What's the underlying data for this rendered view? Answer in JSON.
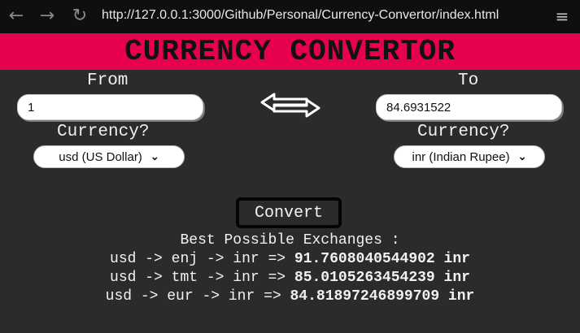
{
  "browser": {
    "url": "http://127.0.0.1:3000/Github/Personal/Currency-Convertor/index.html",
    "back_icon": "←",
    "forward_icon": "→",
    "reload_icon": "↻",
    "menu_icon": "≡"
  },
  "header": {
    "title": "CURRENCY CONVERTOR"
  },
  "from": {
    "label": "From",
    "amount": "1",
    "currency_label": "Currency?",
    "currency_selected": "usd (US Dollar)"
  },
  "to": {
    "label": "To",
    "amount": "84.6931522",
    "currency_label": "Currency?",
    "currency_selected": "inr (Indian Rupee)"
  },
  "swap_icon": "double-arrow-swap-icon",
  "actions": {
    "convert_label": "Convert"
  },
  "results": {
    "heading": "Best Possible Exchanges :",
    "lines": [
      {
        "route": "usd -> enj -> inr =>",
        "value": "91.7608040544902 inr"
      },
      {
        "route": "usd -> tmt -> inr =>",
        "value": "85.0105263454239 inr"
      },
      {
        "route": "usd -> eur -> inr =>",
        "value": "84.81897246899709 inr"
      }
    ]
  },
  "colors": {
    "header_bg": "#e6004f",
    "page_bg": "#2b2b2b",
    "browser_bg": "#0f0f0f"
  }
}
